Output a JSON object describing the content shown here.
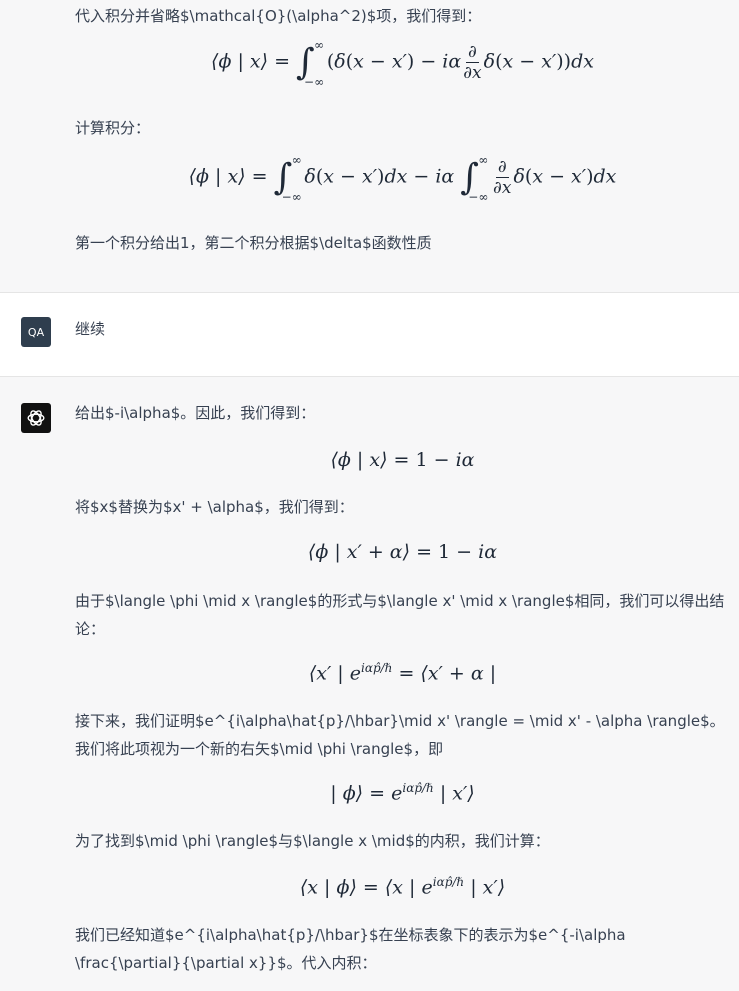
{
  "conversation": {
    "assistant_top": {
      "p1": "代入积分并省略$\\mathcal{O}(\\alpha^2)$项，我们得到：",
      "p2": "计算积分：",
      "p3": "第一个积分给出1，第二个积分根据$\\delta$函数性质"
    },
    "user": {
      "avatar_text": "QA",
      "message": "继续"
    },
    "assistant_bottom": {
      "p1": "给出$-i\\alpha$。因此，我们得到：",
      "p2": "将$x$替换为$x' + \\alpha$，我们得到：",
      "p3": "由于$\\langle \\phi \\mid x \\rangle$的形式与$\\langle x' \\mid x \\rangle$相同，我们可以得出结论：",
      "p4": "接下来，我们证明$e^{i\\alpha\\hat{p}/\\hbar}\\mid x' \\rangle = \\mid x' - \\alpha \\rangle$。我们将此项视为一个新的右矢$\\mid \\phi \\rangle$，即",
      "p5": "为了找到$\\mid \\phi \\rangle$与$\\langle x \\mid$的内积，我们计算：",
      "p6": "我们已经知道$e^{i\\alpha\\hat{p}/\\hbar}$在坐标表象下的表示为$e^{-i\\alpha \\frac{\\partial}{\\partial x}}$。代入内积："
    }
  },
  "colors": {
    "assistant_bg": "#f7f7f8",
    "user_bg": "#ffffff",
    "user_avatar": "#2f3e4e",
    "bot_avatar": "#111111",
    "text": "#374151"
  },
  "icons": {
    "user_avatar": "qa-avatar",
    "bot_avatar": "openai-logo-icon"
  }
}
